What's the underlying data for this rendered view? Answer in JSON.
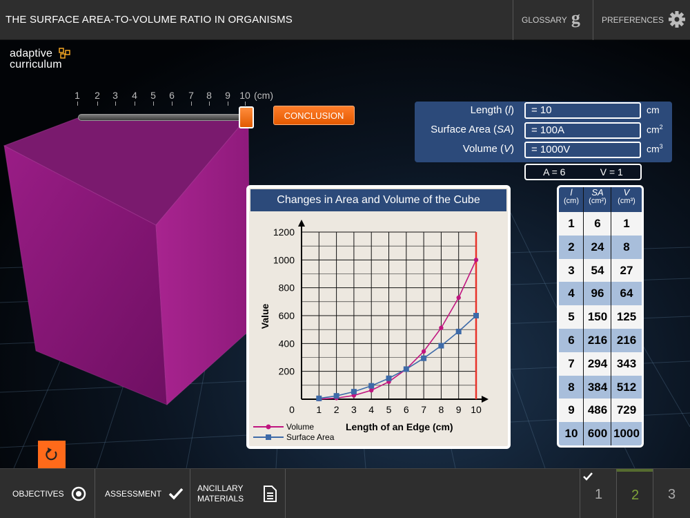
{
  "app": {
    "title": "THE SURFACE AREA-TO-VOLUME RATIO IN ORGANISMS",
    "glossary_label": "GLOSSARY",
    "preferences_label": "PREFERENCES"
  },
  "logo": {
    "line1": "adaptive",
    "line2": "curriculum"
  },
  "slider": {
    "ticks": [
      "1",
      "2",
      "3",
      "4",
      "5",
      "6",
      "7",
      "8",
      "9",
      "10"
    ],
    "unit": "(cm)",
    "value": 10,
    "min": 1,
    "max": 10
  },
  "conclusion_label": "CONCLUSION",
  "readout": {
    "length_label_pre": "Length (",
    "length_sym": "l",
    "length_label_post": ")",
    "length_value": "= 10",
    "length_unit": "cm",
    "sa_label_pre": "Surface Area (",
    "sa_sym": "SA",
    "sa_label_post": ")",
    "sa_value": "= 100A",
    "sa_unit": "cm",
    "sa_unit_exp": "2",
    "vol_label_pre": "Volume (",
    "vol_sym": "V",
    "vol_label_post": ")",
    "vol_value": "= 1000V",
    "vol_unit": "cm",
    "vol_unit_exp": "3",
    "ratio_a": "A = 6",
    "ratio_v": "V = 1"
  },
  "chart_data": {
    "type": "line",
    "title": "Changes in Area and Volume of the Cube",
    "xlabel": "Length of an Edge (cm)",
    "ylabel": "Value",
    "x": [
      1,
      2,
      3,
      4,
      5,
      6,
      7,
      8,
      9,
      10
    ],
    "xlim": [
      0,
      10
    ],
    "ylim": [
      0,
      1200
    ],
    "x_ticks": [
      "0",
      "1",
      "2",
      "3",
      "4",
      "5",
      "6",
      "7",
      "8",
      "9",
      "10"
    ],
    "y_ticks": [
      "200",
      "400",
      "600",
      "800",
      "1000",
      "1200"
    ],
    "y_tick_values": [
      200,
      400,
      600,
      800,
      1000,
      1200
    ],
    "grid": true,
    "legend_position": "bottom-left",
    "current_x": 10,
    "series": [
      {
        "name": "Volume",
        "color": "#c0147f",
        "marker": "circle",
        "values": [
          1,
          8,
          27,
          64,
          125,
          216,
          343,
          512,
          729,
          1000
        ]
      },
      {
        "name": "Surface Area",
        "color": "#3d6aa8",
        "marker": "square",
        "values": [
          6,
          24,
          54,
          96,
          150,
          216,
          294,
          384,
          486,
          600
        ]
      }
    ]
  },
  "table": {
    "headers": [
      {
        "sym": "l",
        "unit": "(cm)"
      },
      {
        "sym": "SA",
        "unit": "(cm²)"
      },
      {
        "sym": "V",
        "unit": "(cm³)"
      }
    ],
    "rows": [
      [
        "1",
        "6",
        "1"
      ],
      [
        "2",
        "24",
        "8"
      ],
      [
        "3",
        "54",
        "27"
      ],
      [
        "4",
        "96",
        "64"
      ],
      [
        "5",
        "150",
        "125"
      ],
      [
        "6",
        "216",
        "216"
      ],
      [
        "7",
        "294",
        "343"
      ],
      [
        "8",
        "384",
        "512"
      ],
      [
        "9",
        "486",
        "729"
      ],
      [
        "10",
        "600",
        "1000"
      ]
    ],
    "stripe_color": "#a8bedb"
  },
  "bottom": {
    "objectives_label": "OBJECTIVES",
    "assessment_label": "ASSESSMENT",
    "ancillary_label": "ANCILLARY MATERIALS",
    "pages": [
      "1",
      "2",
      "3"
    ],
    "current_page": "2"
  },
  "colors": {
    "accent": "#ff6a1a",
    "panel_blue": "#2c4a7a",
    "cube": "#8a1a78"
  },
  "icons": [
    "g-glossary-icon",
    "gear-icon",
    "reset-icon",
    "target-icon",
    "check-icon",
    "document-icon"
  ]
}
